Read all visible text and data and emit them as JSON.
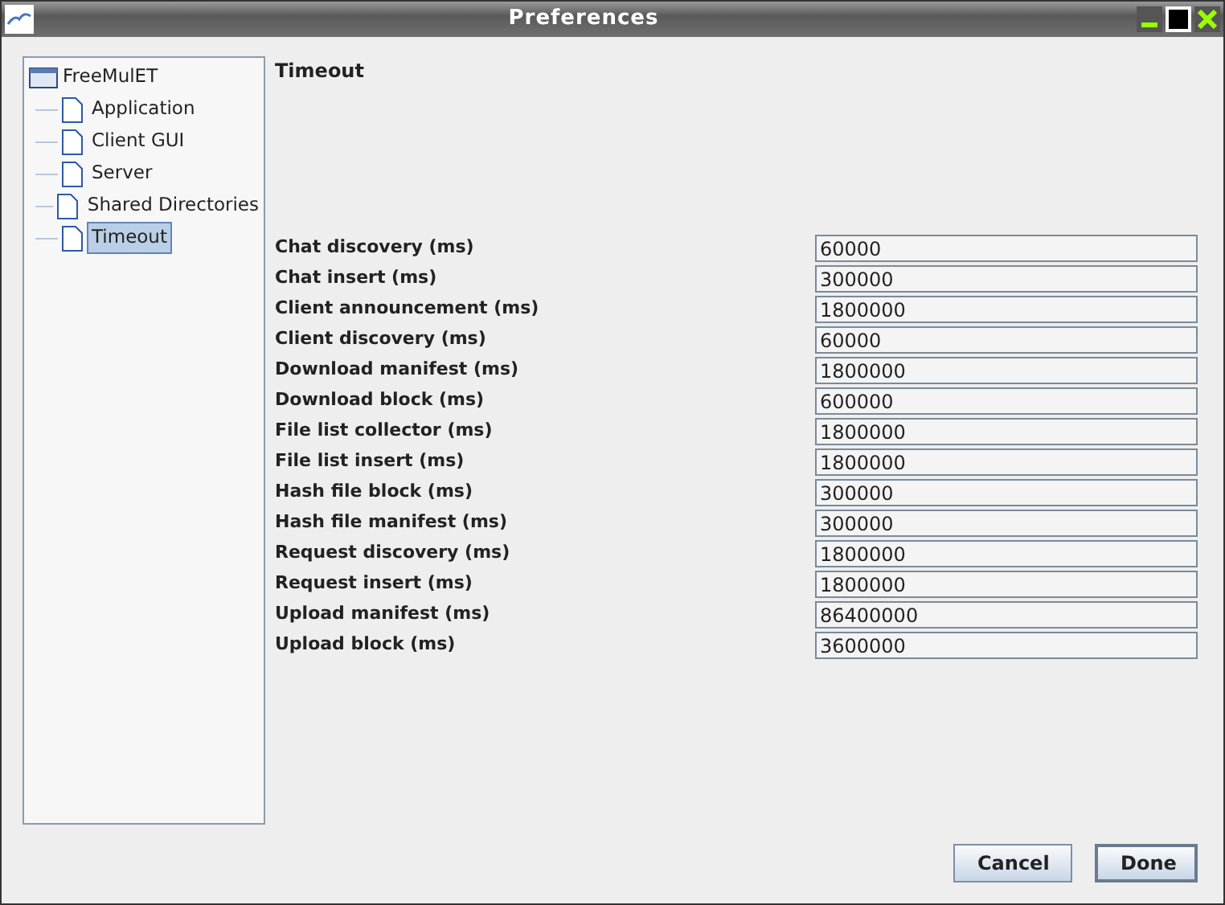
{
  "window": {
    "title": "Preferences"
  },
  "tree": {
    "label": "FreeMulET",
    "expanded": true,
    "children": [
      {
        "label": "Application",
        "selected": false
      },
      {
        "label": "Client GUI",
        "selected": false
      },
      {
        "label": "Server",
        "selected": false
      },
      {
        "label": "Shared Directories",
        "selected": false
      },
      {
        "label": "Timeout",
        "selected": true
      }
    ]
  },
  "panel": {
    "title": "Timeout",
    "fields": [
      {
        "label": "Chat discovery (ms)",
        "value": "60000"
      },
      {
        "label": "Chat insert (ms)",
        "value": "300000"
      },
      {
        "label": "Client announcement (ms)",
        "value": "1800000"
      },
      {
        "label": "Client discovery (ms)",
        "value": "60000"
      },
      {
        "label": "Download manifest (ms)",
        "value": "1800000"
      },
      {
        "label": "Download block (ms)",
        "value": "600000"
      },
      {
        "label": "File list collector (ms)",
        "value": "1800000"
      },
      {
        "label": "File list insert (ms)",
        "value": "1800000"
      },
      {
        "label": "Hash file block (ms)",
        "value": "300000"
      },
      {
        "label": "Hash file manifest (ms)",
        "value": "300000"
      },
      {
        "label": "Request discovery (ms)",
        "value": "1800000"
      },
      {
        "label": "Request insert (ms)",
        "value": "1800000"
      },
      {
        "label": "Upload manifest (ms)",
        "value": "86400000"
      },
      {
        "label": "Upload block (ms)",
        "value": "3600000"
      }
    ]
  },
  "buttons": [
    {
      "label": "Cancel"
    },
    {
      "label": "Done"
    }
  ]
}
